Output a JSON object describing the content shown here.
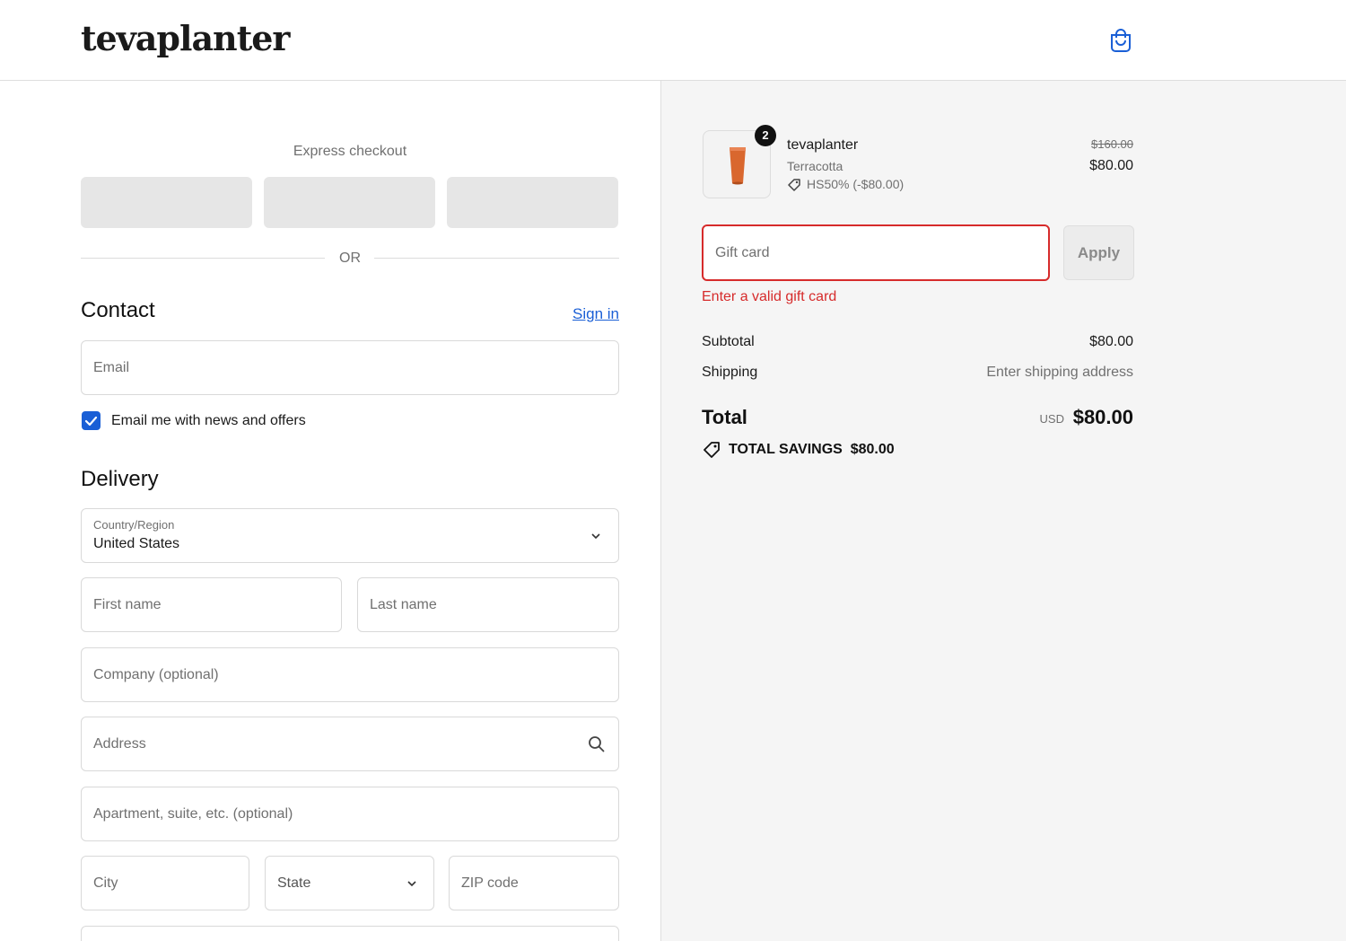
{
  "header": {
    "logo": "tevaplanter",
    "cart_icon": "shopping-bag-icon"
  },
  "express": {
    "title": "Express checkout",
    "buttons": [
      "",
      "",
      ""
    ],
    "or": "OR"
  },
  "contact": {
    "title": "Contact",
    "sign_in": "Sign in",
    "email_placeholder": "Email",
    "newsletter_label": "Email me with news and offers",
    "newsletter_checked": true
  },
  "delivery": {
    "title": "Delivery",
    "country_label": "Country/Region",
    "country_value": "United States",
    "first_name": "First name",
    "last_name": "Last name",
    "company": "Company (optional)",
    "address": "Address",
    "apartment": "Apartment, suite, etc. (optional)",
    "city": "City",
    "state": "State",
    "zip": "ZIP code"
  },
  "order": {
    "item": {
      "name": "tevaplanter",
      "variant": "Terracotta",
      "discount": "HS50% (-$80.00)",
      "quantity": "2",
      "price_original": "$160.00",
      "price_final": "$80.00"
    },
    "gift_card": {
      "placeholder": "Gift card",
      "apply": "Apply",
      "error": "Enter a valid gift card"
    },
    "subtotal_label": "Subtotal",
    "subtotal_value": "$80.00",
    "shipping_label": "Shipping",
    "shipping_value": "Enter shipping address",
    "total_label": "Total",
    "total_currency": "USD",
    "total_value": "$80.00",
    "savings": "TOTAL SAVINGS  $80.00"
  },
  "colors": {
    "accent": "#1a5fd6",
    "error": "#d62b2b",
    "panel": "#f5f5f5"
  }
}
